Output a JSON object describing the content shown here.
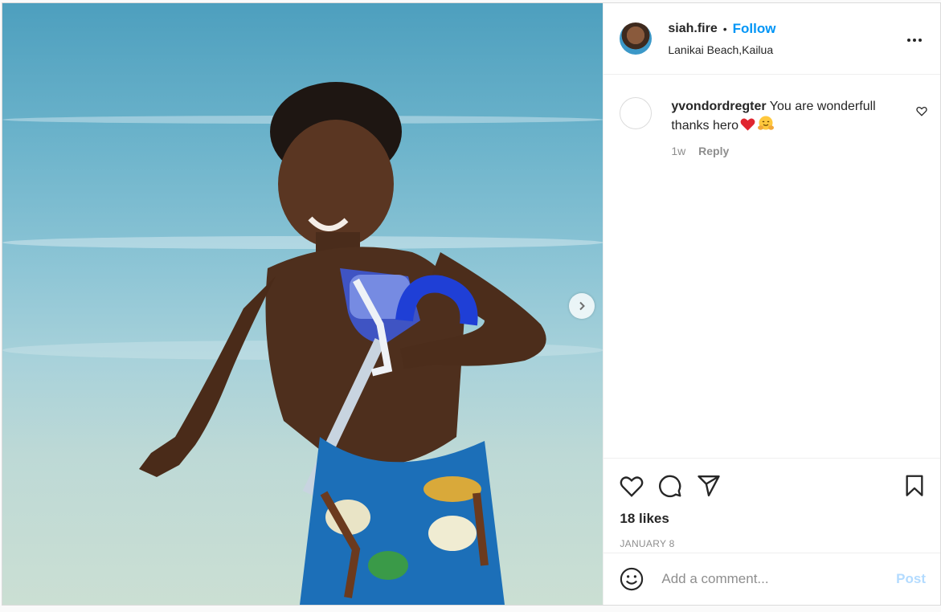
{
  "post": {
    "username": "siah.fire",
    "separator": "•",
    "follow_label": "Follow",
    "location": "Lanikai Beach,Kailua",
    "more_icon": "more-horizontal-icon"
  },
  "media": {
    "next_icon": "chevron-right-icon"
  },
  "comments": [
    {
      "username": "yvondordregter",
      "text": "You are wonderfull thanks hero",
      "emojis": [
        "red-heart",
        "hugging-face"
      ],
      "time": "1w",
      "reply_label": "Reply"
    }
  ],
  "actions": {
    "icons": [
      "heart-icon",
      "comment-icon",
      "share-icon",
      "bookmark-icon"
    ],
    "likes": "18 likes",
    "date": "JANUARY 8"
  },
  "add_comment": {
    "placeholder": "Add a comment...",
    "post_label": "Post"
  },
  "colors": {
    "follow": "#0095f6",
    "post_disabled": "#b3dbff"
  }
}
